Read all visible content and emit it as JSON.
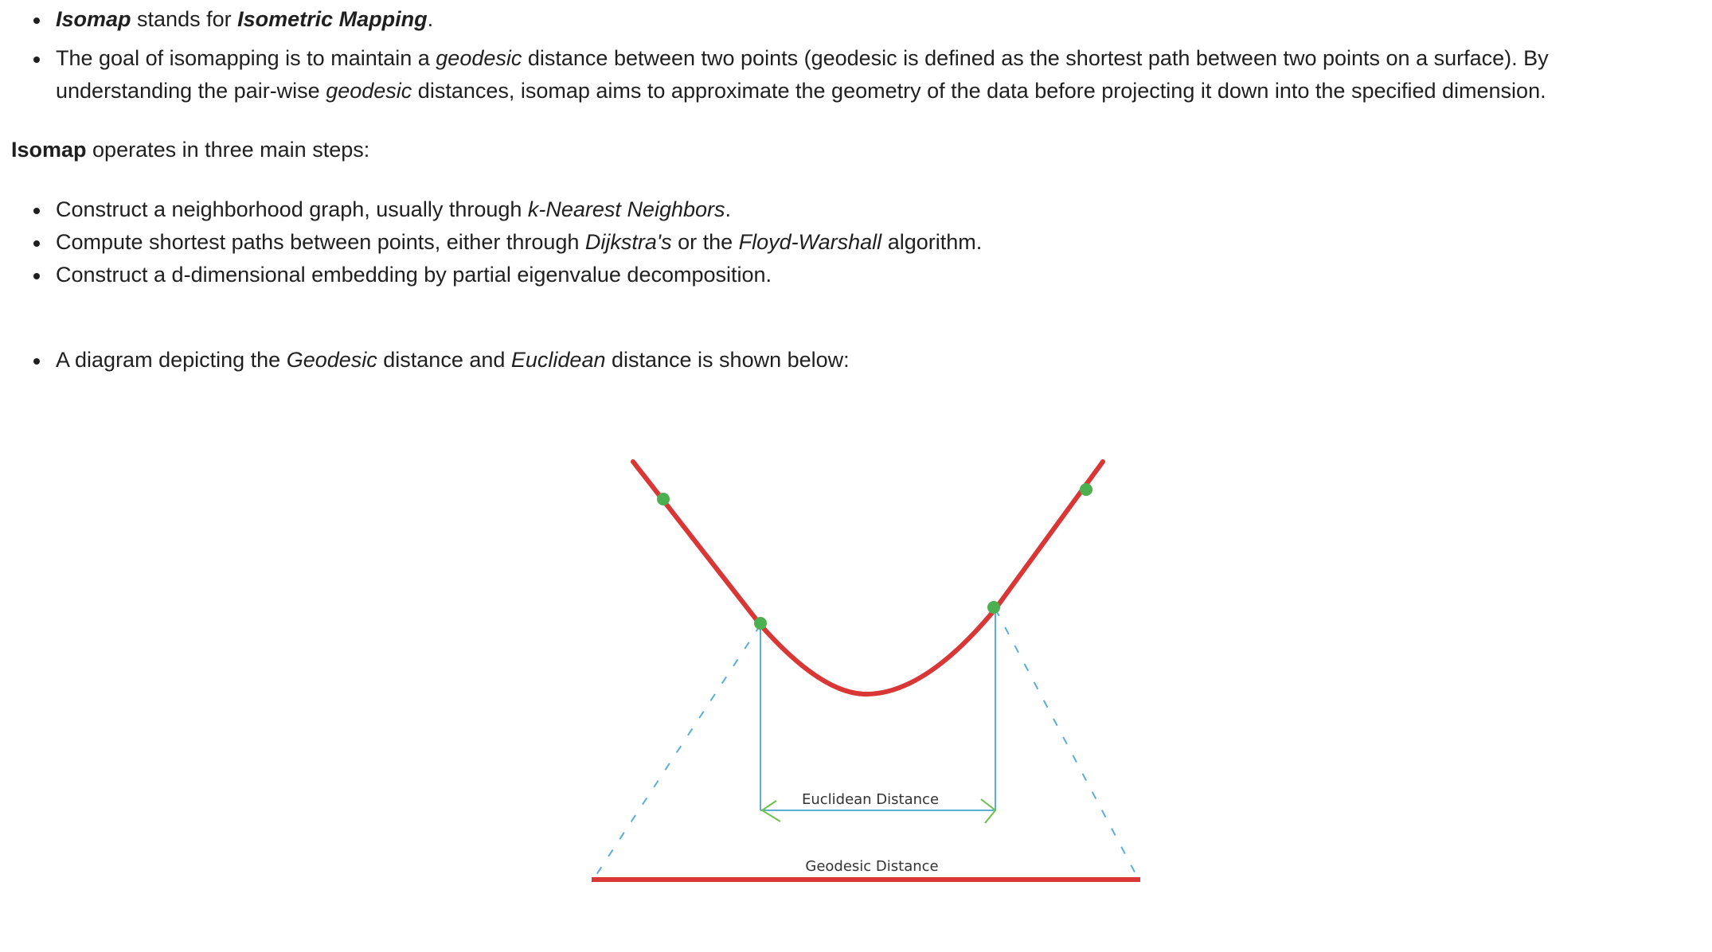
{
  "intro_bullets": {
    "b1": {
      "term": "Isomap",
      "mid": " stands for ",
      "expansion": "Isometric Mapping",
      "end": "."
    },
    "b2": {
      "t1": "The goal of isomapping is to maintain a ",
      "geodesic1": "geodesic",
      "t2": " distance between two points (geodesic is defined as the shortest path between two points on a surface). By understanding the pair-wise ",
      "geodesic2": "geodesic",
      "t3": " distances, isomap aims to approximate the geometry of the data before projecting it down into the specified dimension."
    }
  },
  "steps_heading": {
    "term": "Isomap",
    "rest": " operates in three main steps:"
  },
  "steps": {
    "s1": {
      "t1": "Construct a neighborhood graph, usually through ",
      "knn": "k-Nearest Neighbors",
      "end": "."
    },
    "s2": {
      "t1": "Compute shortest paths between points, either through ",
      "dijkstra": "Dijkstra's",
      "t2": " or the ",
      "floyd": "Floyd-Warshall",
      "t3": " algorithm."
    },
    "s3": {
      "t1": "Construct a d-dimensional embedding by partial eigenvalue decomposition."
    }
  },
  "diagram_bullet": {
    "t1": "A diagram depicting the ",
    "geodesic": "Geodesic",
    "t2": " distance and ",
    "euclidean": "Euclidean",
    "t3": " distance is shown below:"
  },
  "diagram": {
    "euclidean_label": "Euclidean Distance",
    "geodesic_label": "Geodesic Distance",
    "colors": {
      "curve": "#d93636",
      "points": "#4caf50",
      "guides": "#5aaed8",
      "arrow_heads": "#6cc24a"
    }
  }
}
